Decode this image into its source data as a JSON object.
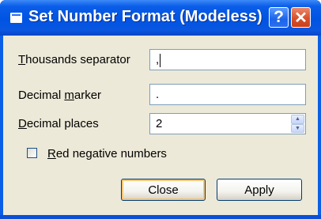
{
  "window": {
    "title": "Set Number Format (Modeless)",
    "help_glyph": "?",
    "close_glyph": "✕"
  },
  "form": {
    "thousands": {
      "label_underline": "T",
      "label_rest": "housands separator",
      "value": ","
    },
    "decimal_marker": {
      "label_pre": "Decimal ",
      "label_underline": "m",
      "label_rest": "arker",
      "value": "."
    },
    "decimal_places": {
      "label_underline": "D",
      "label_rest": "ecimal places",
      "value": "2"
    },
    "red_negative": {
      "label_underline": "R",
      "label_rest": "ed negative numbers",
      "checked": false
    }
  },
  "buttons": {
    "close": "Close",
    "apply": "Apply"
  },
  "icons": {
    "spin_up": "▲",
    "spin_down": "▼"
  },
  "colors": {
    "titlebar": "#0054e3",
    "dialog_bg": "#ece9d8",
    "close_button": "#d8502a"
  }
}
